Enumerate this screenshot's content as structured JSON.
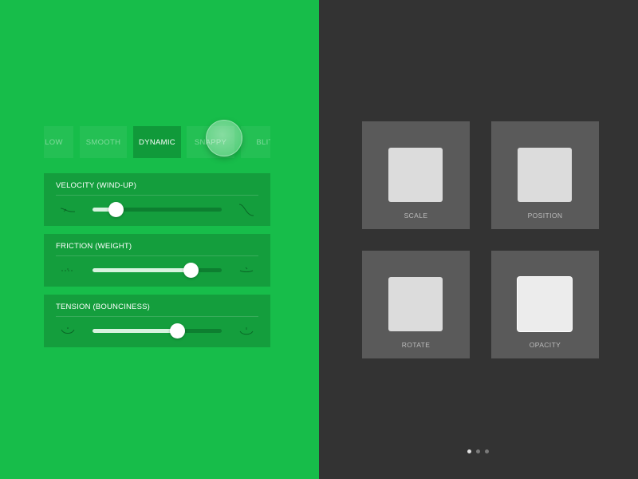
{
  "colors": {
    "left_background": "#17bd4a",
    "right_background": "#333333",
    "card_background": "#149e3d",
    "active_tab": "#109a3a",
    "tile_background": "#5a5a5a"
  },
  "presets": {
    "tabs": [
      {
        "label": "LOW",
        "active": false
      },
      {
        "label": "SMOOTH",
        "active": false
      },
      {
        "label": "DYNAMIC",
        "active": true
      },
      {
        "label": "SNAPPY",
        "active": false
      },
      {
        "label": "BLIT",
        "active": false
      }
    ]
  },
  "controls": [
    {
      "title": "VELOCITY (WIND-UP)",
      "value_fraction": 0.18,
      "left_icon": "wind-up-low-curve-icon",
      "right_icon": "wind-up-high-curve-icon"
    },
    {
      "title": "FRICTION (WEIGHT)",
      "value_fraction": 0.76,
      "left_icon": "friction-light-icon",
      "right_icon": "friction-heavy-icon"
    },
    {
      "title": "TENSION (BOUNCINESS)",
      "value_fraction": 0.66,
      "left_icon": "bounce-low-icon",
      "right_icon": "bounce-high-icon"
    }
  ],
  "tiles": [
    {
      "label": "SCALE",
      "selected": false
    },
    {
      "label": "POSITION",
      "selected": false
    },
    {
      "label": "ROTATE",
      "selected": false
    },
    {
      "label": "OPACITY",
      "selected": true
    }
  ],
  "pagination": {
    "count": 3,
    "active_index": 0
  }
}
